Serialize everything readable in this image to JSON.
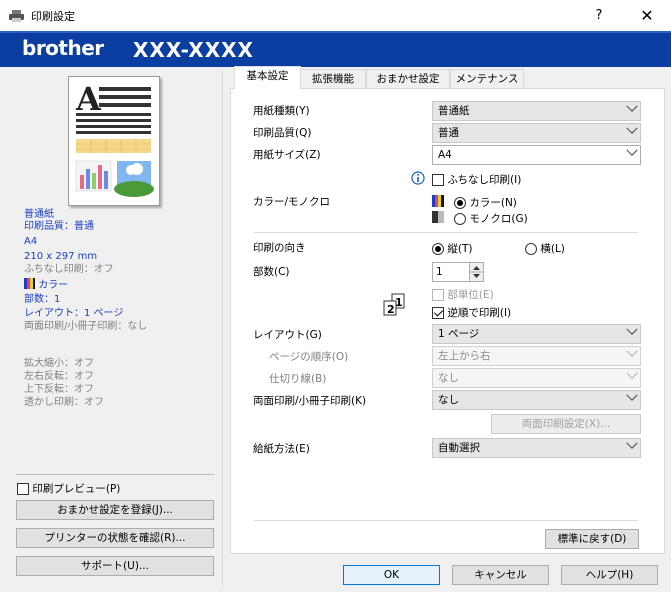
{
  "window": {
    "title": "印刷設定",
    "help": "?",
    "close": "✕"
  },
  "brand": {
    "logo": "brother",
    "model": "XXX-XXXX"
  },
  "summary": {
    "paper_type": "普通紙",
    "quality": "印刷品質：普通",
    "size": "A4",
    "dimensions": "210 x 297 mm",
    "borderless": "ふちなし印刷：オフ",
    "color": "カラー",
    "copies": "部数：1",
    "layout": "レイアウト：1 ページ",
    "duplex": "両面印刷/小冊子印刷：なし",
    "scale": "拡大縮小：オフ",
    "mirror": "左右反転：オフ",
    "reverse": "上下反転：オフ",
    "watermark": "透かし印刷：オフ"
  },
  "left": {
    "preview_label": "印刷プレビュー(P)",
    "add_profile": "おまかせ設定を登録(J)...",
    "printer_status": "プリンターの状態を確認(R)...",
    "support": "サポート(U)..."
  },
  "tabs": [
    {
      "label": "基本設定",
      "active": true
    },
    {
      "label": "拡張機能"
    },
    {
      "label": "おまかせ設定"
    },
    {
      "label": "メンテナンス"
    }
  ],
  "basic": {
    "media_type_label": "用紙種類(Y)",
    "media_type_value": "普通紙",
    "quality_label": "印刷品質(Q)",
    "quality_value": "普通",
    "size_label": "用紙サイズ(Z)",
    "size_value": "A4",
    "borderless_label": "ふちなし印刷(I)",
    "color_label": "カラー/モノクロ",
    "color_opt": "カラー(N)",
    "mono_opt": "モノクロ(G)",
    "orient_label": "印刷の向き",
    "portrait": "縦(T)",
    "landscape": "横(L)",
    "copies_label": "部数(C)",
    "copies_value": "1",
    "collate": "部単位(E)",
    "reverse": "逆順で印刷(I)",
    "layout_label": "レイアウト(G)",
    "layout_value": "1 ページ",
    "order_label": "ページの順序(O)",
    "order_value": "左上から右",
    "border_label": "仕切り線(B)",
    "border_value": "なし",
    "duplex_label": "両面印刷/小冊子印刷(K)",
    "duplex_value": "なし",
    "duplex_settings": "両面印刷設定(X)...",
    "source_label": "給紙方法(E)",
    "source_value": "自動選択",
    "default_btn": "標準に戻す(D)"
  },
  "footer": {
    "ok": "OK",
    "cancel": "キャンセル",
    "help": "ヘルプ(H)"
  },
  "colors": {
    "brand_bar": "#0b3ea0",
    "summary_text": "#1a3fbf"
  },
  "icons": [
    "printer-icon",
    "info-icon",
    "color-icon",
    "mono-icon",
    "collate-icon"
  ]
}
